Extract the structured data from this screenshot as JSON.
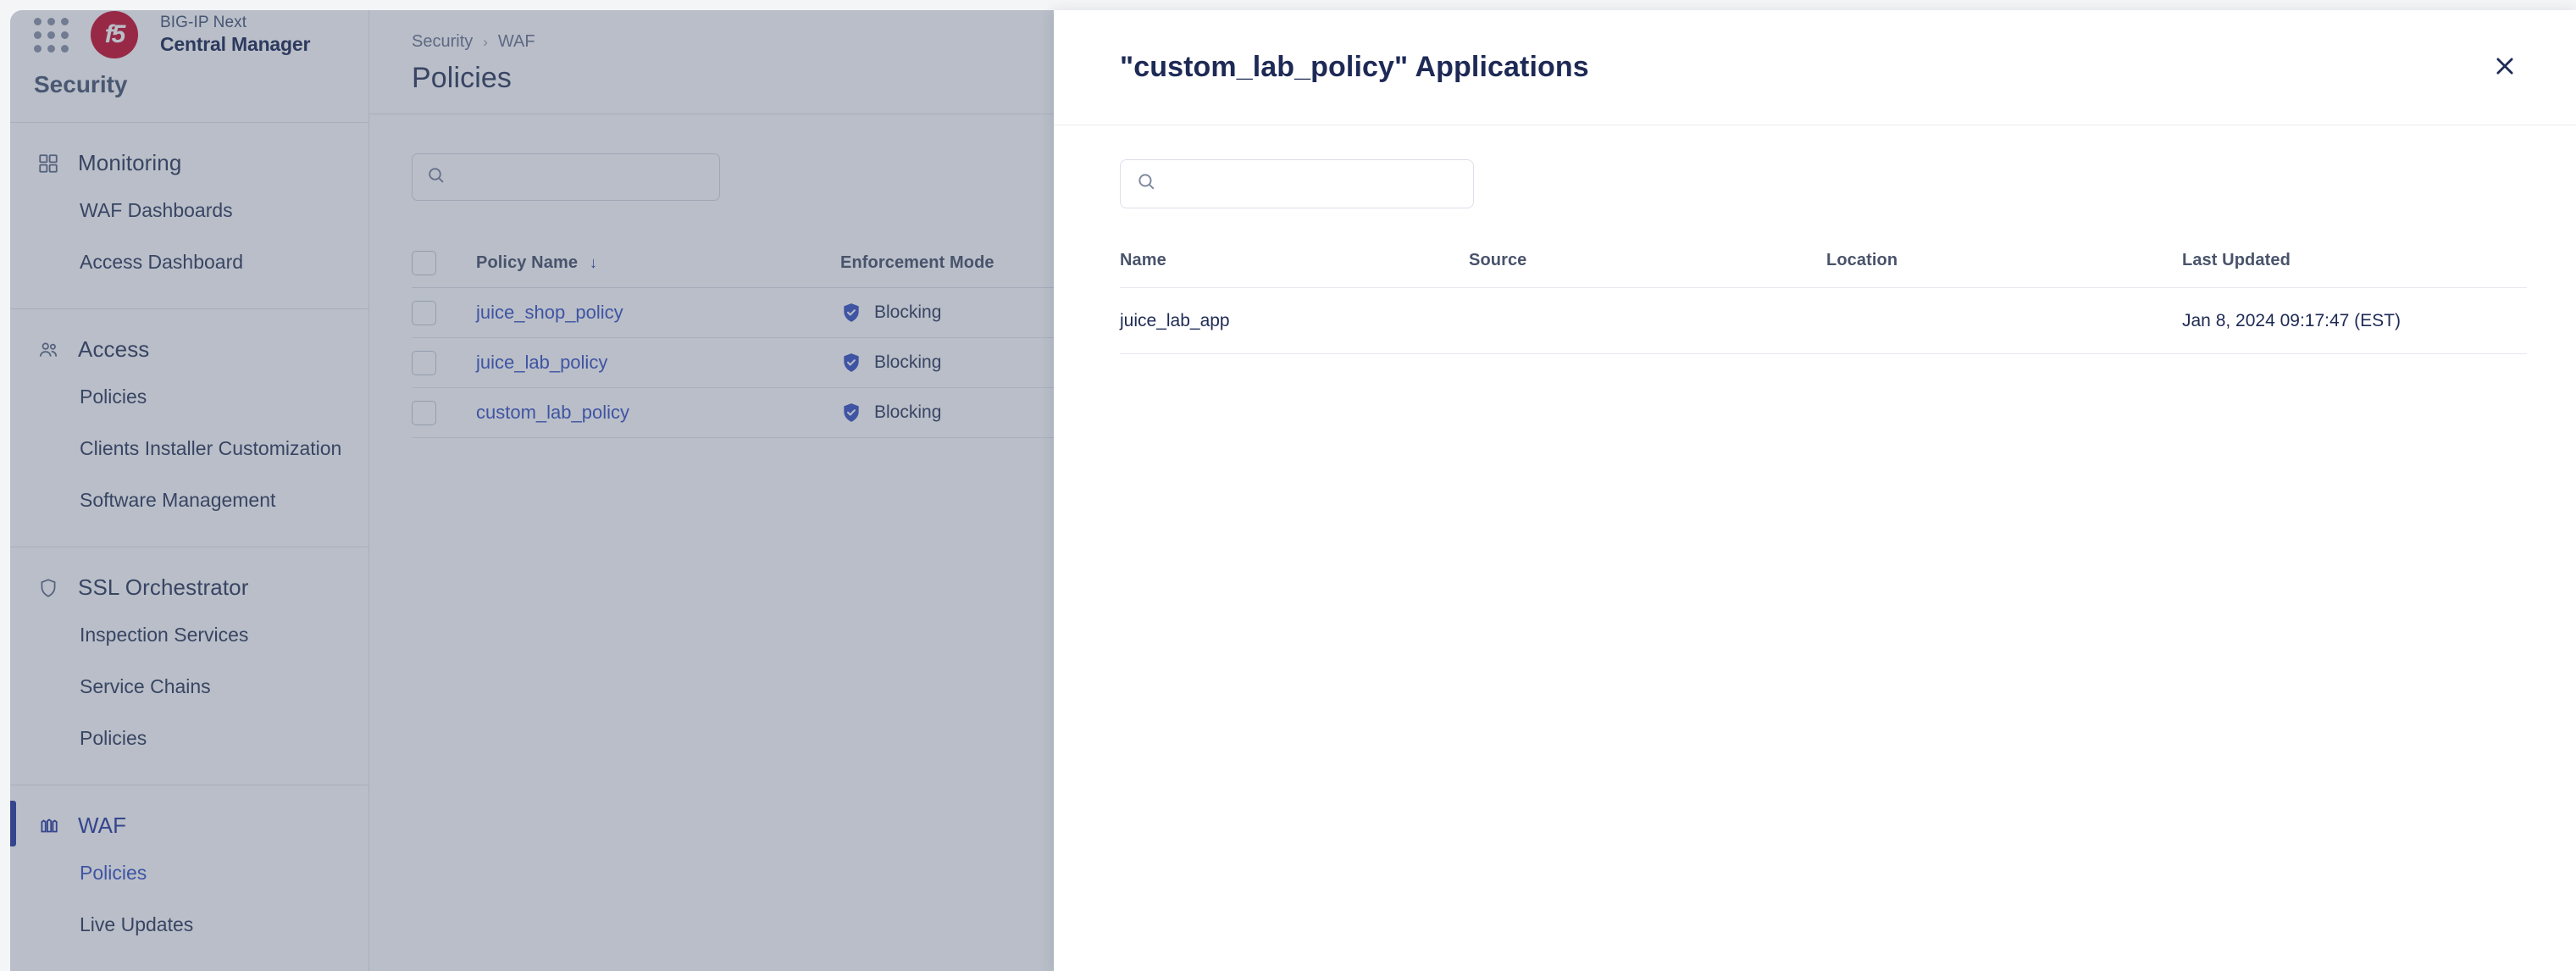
{
  "brand": {
    "logo_text": "f5",
    "line1": "BIG-IP Next",
    "line2": "Central Manager",
    "app_launcher_icon": "grid-dots-icon"
  },
  "sidebar": {
    "section_title": "Security",
    "groups": [
      {
        "label": "Monitoring",
        "icon": "dashboard-grid-icon",
        "active": false,
        "items": [
          {
            "label": "WAF Dashboards",
            "selected": false
          },
          {
            "label": "Access Dashboard",
            "selected": false
          }
        ]
      },
      {
        "label": "Access",
        "icon": "users-icon",
        "active": false,
        "items": [
          {
            "label": "Policies",
            "selected": false
          },
          {
            "label": "Clients Installer Customization",
            "selected": false
          },
          {
            "label": "Software Management",
            "selected": false
          }
        ]
      },
      {
        "label": "SSL Orchestrator",
        "icon": "shield-outline-icon",
        "active": false,
        "items": [
          {
            "label": "Inspection Services",
            "selected": false
          },
          {
            "label": "Service Chains",
            "selected": false
          },
          {
            "label": "Policies",
            "selected": false
          }
        ]
      },
      {
        "label": "WAF",
        "icon": "waf-bars-icon",
        "active": true,
        "items": [
          {
            "label": "Policies",
            "selected": true
          },
          {
            "label": "Live Updates",
            "selected": false
          }
        ]
      }
    ]
  },
  "page": {
    "breadcrumb": [
      "Security",
      "WAF"
    ],
    "breadcrumb_separator": "›",
    "title": "Policies",
    "search": {
      "value": "",
      "placeholder": ""
    },
    "table": {
      "columns": [
        "Policy Name",
        "Enforcement Mode"
      ],
      "sort_indicator": "↓",
      "rows": [
        {
          "name": "juice_shop_policy",
          "mode": "Blocking",
          "mode_icon": "shield-check-icon"
        },
        {
          "name": "juice_lab_policy",
          "mode": "Blocking",
          "mode_icon": "shield-check-icon"
        },
        {
          "name": "custom_lab_policy",
          "mode": "Blocking",
          "mode_icon": "shield-check-icon"
        }
      ]
    }
  },
  "drawer": {
    "title": "\"custom_lab_policy\" Applications",
    "close_icon": "close-icon",
    "search": {
      "value": "",
      "placeholder": ""
    },
    "table": {
      "columns": [
        "Name",
        "Source",
        "Location",
        "Last Updated"
      ],
      "rows": [
        {
          "name": "juice_lab_app",
          "source": "",
          "location": "",
          "last_updated": "Jan 8, 2024 09:17:47 (EST)"
        }
      ]
    }
  },
  "colors": {
    "brand_red": "#c8102e",
    "accent_blue": "#2b3da0",
    "link_blue": "#3b54c4",
    "text_dark": "#1e2a55",
    "scrim": "rgba(70,84,110,0.38)"
  }
}
